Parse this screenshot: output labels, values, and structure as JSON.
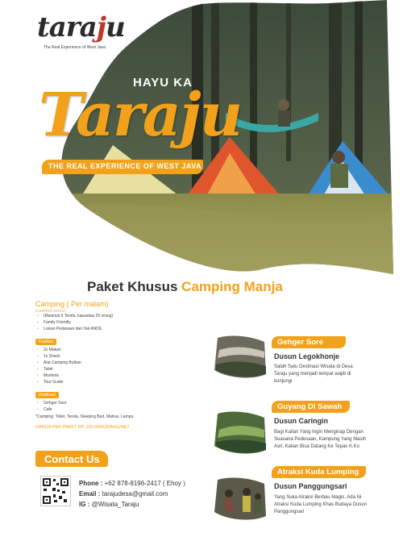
{
  "logo": {
    "name_pre": "tara",
    "name_accent": "j",
    "name_post": "u",
    "subtitle": "The Real Experience of West Java"
  },
  "hero": {
    "hayu": "HAYU KA",
    "title": "Taraju",
    "tagline": "THE REAL EXPERIENCE OF WEST JAVA"
  },
  "heading": {
    "part1": "Paket Khusus",
    "part2": "Camping Manja"
  },
  "camping": {
    "header": "Camping ( Per malam)",
    "label": "CAMPING MANJA",
    "items": [
      "(Maximal 6 Tenda, kapasitas 20 orang)",
      "Family Friendly",
      "Lokasi Pedesaan dan Tak ANDIL"
    ]
  },
  "fasilitas": {
    "label": "Fasilitas",
    "items": [
      "2x Makan",
      "1x Snack",
      "Alat Camping Bulkan",
      "Toilet",
      "Mushola",
      "Tour Guide"
    ]
  },
  "destinasi": {
    "label": "Destinasi",
    "items": [
      "Gehger Sore",
      "Cafe"
    ]
  },
  "note": "*Camping: Toilet, Tenda, Sleeping Bed, Matras, Lampu.",
  "price": "HARGA PER PAKET RP. 250.000/ORANG/NET",
  "contact": {
    "title": "Contact Us",
    "phone_label": "Phone :",
    "phone": "+62 878-8196-2417 ( Ehoy )",
    "email_label": "Email :",
    "email": "tarajudesa@gmail.com",
    "ig_label": "IG :",
    "ig": "@Wisata_Taraju"
  },
  "spots": [
    {
      "title": "Gehger Sore",
      "dusun": "Dusun Legokhonje",
      "desc": "Salah Satu Destinasi Wisata di Desa Taraju yang menjadi tempat wajib di kunjungi"
    },
    {
      "title": "Guyang Di Sawah",
      "dusun": "Dusun Caringin",
      "desc": "Bagi Kalian Yang Ingin Menginap Dengan Suasana Pedesaan, Kampung Yang Masih Asri, Kalian Bisa Datang Ke Tepas K.Ko"
    },
    {
      "title": "Atraksi Kuda Lumping",
      "dusun": "Dusun Panggungsari",
      "desc": "Yang Suka Atraksi Berbau Magis, Ada Ni Atraksi Kuda Lumping Khas Budaya Dusun Panggungsari"
    }
  ],
  "colors": {
    "accent": "#f2a21a",
    "dark": "#333333"
  }
}
